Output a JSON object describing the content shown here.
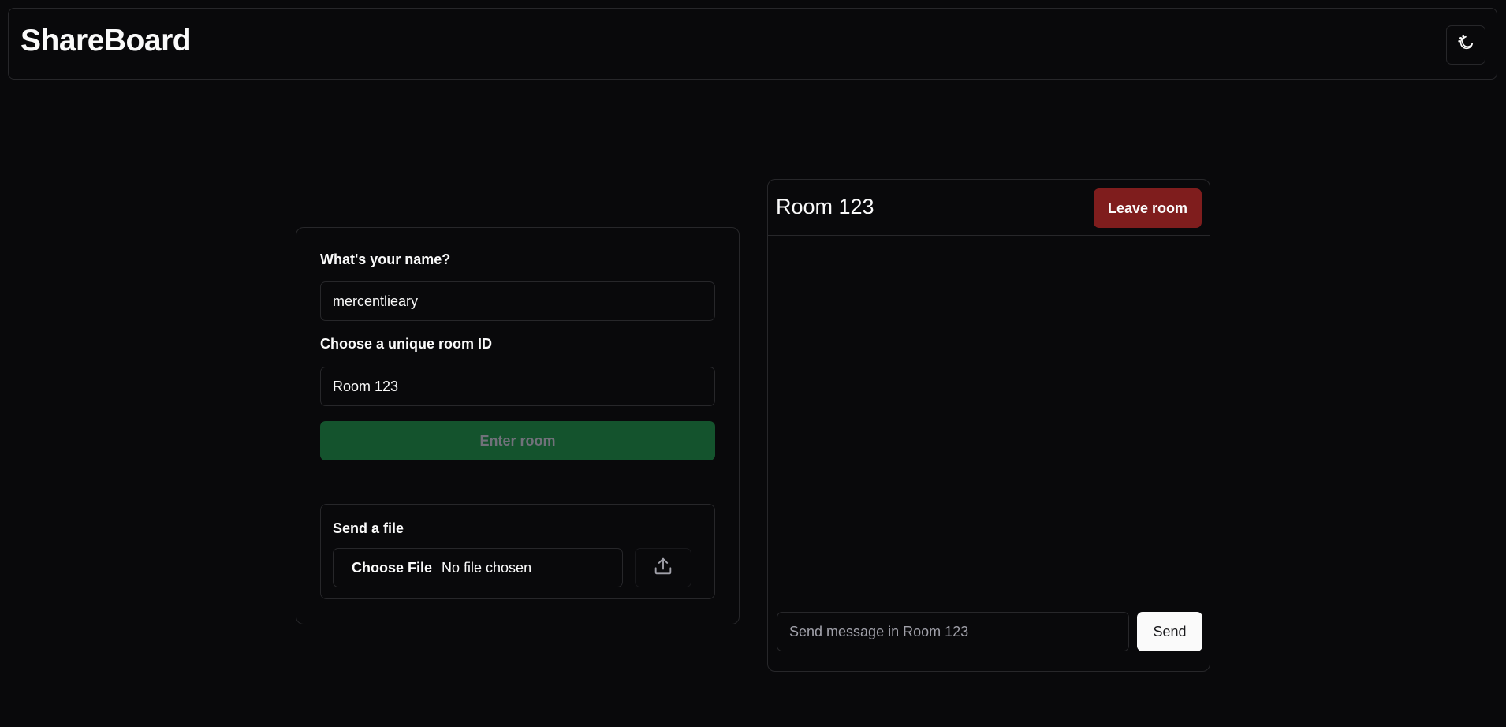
{
  "header": {
    "title": "ShareBoard",
    "theme_toggle_icon": "moon-stars-icon"
  },
  "join_form": {
    "name_label": "What's your name?",
    "name_value": "mercentlieary",
    "room_label": "Choose a unique room ID",
    "room_value": "Room 123",
    "enter_button": "Enter room"
  },
  "file_panel": {
    "title": "Send a file",
    "choose_button": "Choose File",
    "file_status": "No file chosen",
    "upload_icon": "upload-icon"
  },
  "room": {
    "title": "Room 123",
    "leave_button": "Leave room",
    "message_placeholder": "Send message in Room 123",
    "send_button": "Send"
  },
  "colors": {
    "background": "#09090b",
    "border": "#27272a",
    "enter_button": "#14532d",
    "leave_button": "#7f1d1d",
    "send_button": "#fafafa"
  }
}
